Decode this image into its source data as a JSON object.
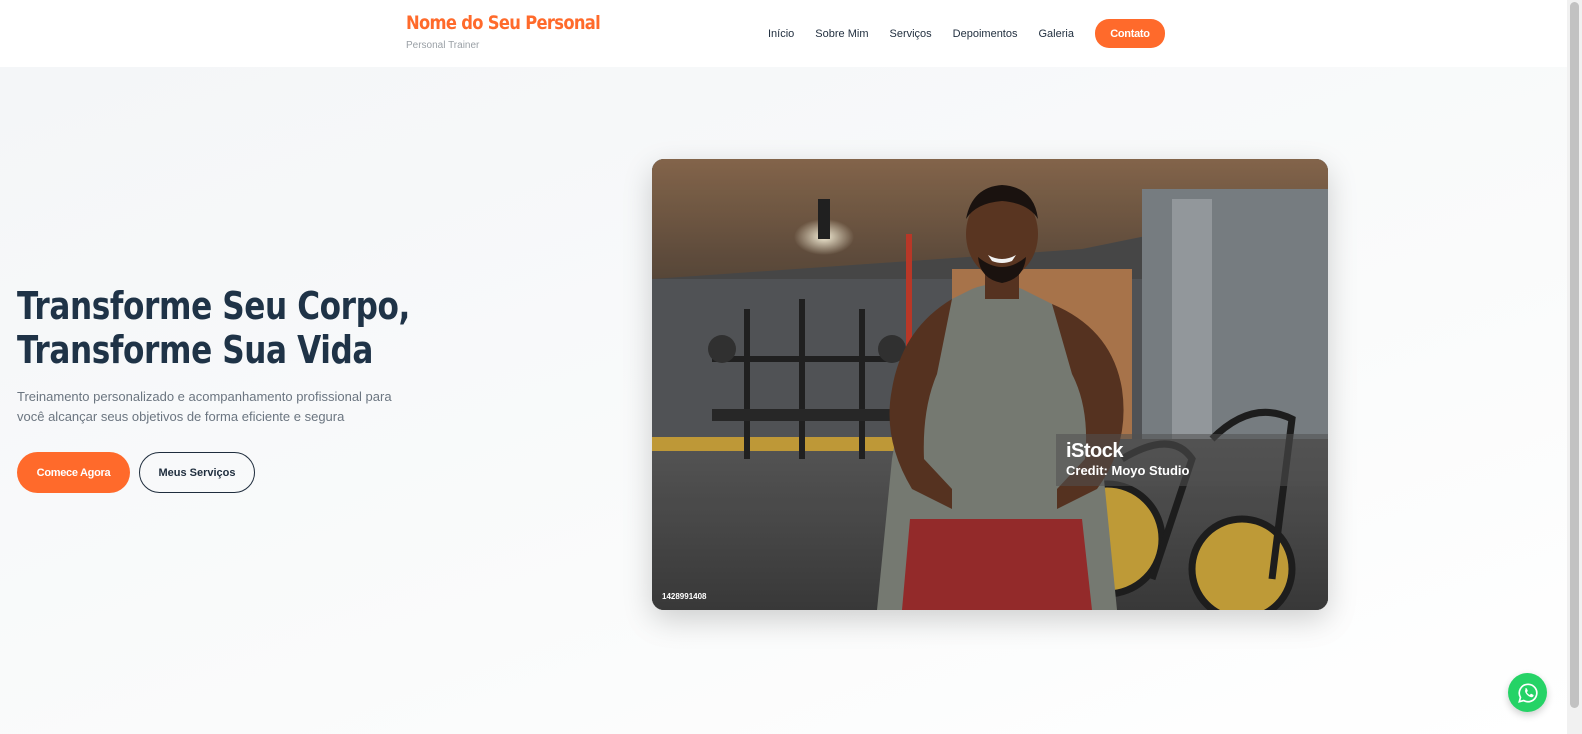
{
  "header": {
    "brand_name": "Nome do Seu Personal",
    "brand_sub": "Personal Trainer",
    "nav": [
      "Início",
      "Sobre Mim",
      "Serviços",
      "Depoimentos",
      "Galeria"
    ],
    "contact_label": "Contato"
  },
  "hero": {
    "title_line1": "Transforme Seu Corpo,",
    "title_line2": "Transforme Sua Vida",
    "subtitle": "Treinamento personalizado e acompanhamento profissional para você alcançar seus objetivos de forma eficiente e segura",
    "primary_label": "Comece Agora",
    "secondary_label": "Meus Serviços"
  },
  "photo": {
    "watermark_logo": "iStock",
    "watermark_credit": "Credit: Moyo Studio",
    "image_id": "1428991408"
  },
  "icons": {
    "whatsapp": "whatsapp-icon"
  },
  "colors": {
    "accent": "#ff6a2b",
    "dark": "#1f3347",
    "whatsapp": "#25d366"
  }
}
